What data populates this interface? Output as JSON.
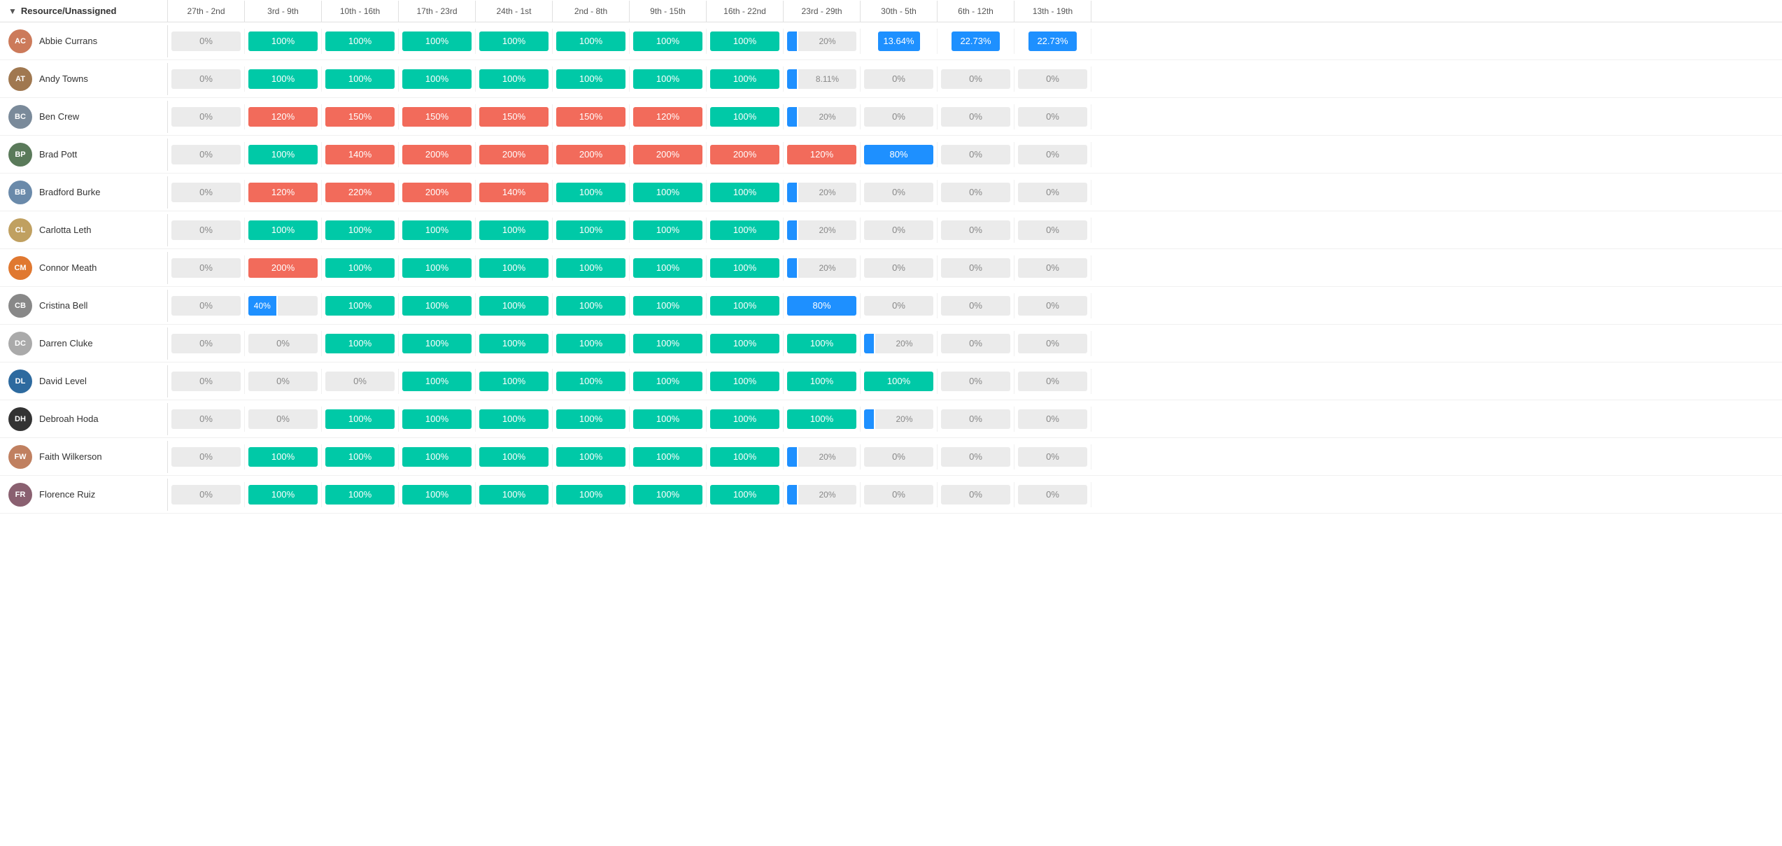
{
  "header": {
    "resource_label": "Resource/Unassigned",
    "columns": [
      "27th - 2nd",
      "3rd - 9th",
      "10th - 16th",
      "17th - 23rd",
      "24th - 1st",
      "2nd - 8th",
      "9th - 15th",
      "16th - 22nd",
      "23rd - 29th",
      "30th - 5th",
      "6th - 12th",
      "13th - 19th"
    ]
  },
  "rows": [
    {
      "name": "Abbie Currans",
      "avatar_type": "image",
      "avatar_color": "#cc7a5a",
      "initials": "AC",
      "cells": [
        {
          "type": "zero",
          "value": "0%"
        },
        {
          "type": "green",
          "value": "100%"
        },
        {
          "type": "green",
          "value": "100%"
        },
        {
          "type": "green",
          "value": "100%"
        },
        {
          "type": "green",
          "value": "100%"
        },
        {
          "type": "green",
          "value": "100%"
        },
        {
          "type": "green",
          "value": "100%"
        },
        {
          "type": "green",
          "value": "100%"
        },
        {
          "type": "partial",
          "blue_pct": 20,
          "value": "20%"
        },
        {
          "type": "blue_partial",
          "value": "13.64%",
          "pct": 60
        },
        {
          "type": "blue_partial",
          "value": "22.73%",
          "pct": 70
        },
        {
          "type": "blue_partial",
          "value": "22.73%",
          "pct": 70
        }
      ]
    },
    {
      "name": "Andy Towns",
      "avatar_type": "image",
      "avatar_color": "#a07850",
      "initials": "AT",
      "cells": [
        {
          "type": "zero",
          "value": "0%"
        },
        {
          "type": "green",
          "value": "100%"
        },
        {
          "type": "green",
          "value": "100%"
        },
        {
          "type": "green",
          "value": "100%"
        },
        {
          "type": "green",
          "value": "100%"
        },
        {
          "type": "green",
          "value": "100%"
        },
        {
          "type": "green",
          "value": "100%"
        },
        {
          "type": "green",
          "value": "100%"
        },
        {
          "type": "partial",
          "blue_pct": 15,
          "value": "8.11%"
        },
        {
          "type": "zero",
          "value": "0%"
        },
        {
          "type": "zero",
          "value": "0%"
        },
        {
          "type": "zero",
          "value": "0%"
        }
      ]
    },
    {
      "name": "Ben Crew",
      "avatar_type": "image",
      "avatar_color": "#7a8a9a",
      "initials": "BC",
      "cells": [
        {
          "type": "zero",
          "value": "0%"
        },
        {
          "type": "red",
          "value": "120%"
        },
        {
          "type": "red",
          "value": "150%"
        },
        {
          "type": "red",
          "value": "150%"
        },
        {
          "type": "red",
          "value": "150%"
        },
        {
          "type": "red",
          "value": "150%"
        },
        {
          "type": "red",
          "value": "120%"
        },
        {
          "type": "green",
          "value": "100%"
        },
        {
          "type": "partial",
          "blue_pct": 20,
          "value": "20%"
        },
        {
          "type": "zero",
          "value": "0%"
        },
        {
          "type": "zero",
          "value": "0%"
        },
        {
          "type": "zero",
          "value": "0%"
        }
      ]
    },
    {
      "name": "Brad Pott",
      "avatar_type": "image",
      "avatar_color": "#5a7a5a",
      "initials": "BP",
      "cells": [
        {
          "type": "zero",
          "value": "0%"
        },
        {
          "type": "green",
          "value": "100%"
        },
        {
          "type": "red",
          "value": "140%"
        },
        {
          "type": "red",
          "value": "200%"
        },
        {
          "type": "red",
          "value": "200%"
        },
        {
          "type": "red",
          "value": "200%"
        },
        {
          "type": "red",
          "value": "200%"
        },
        {
          "type": "red",
          "value": "200%"
        },
        {
          "type": "red",
          "value": "120%"
        },
        {
          "type": "blue",
          "value": "80%"
        },
        {
          "type": "zero",
          "value": "0%"
        },
        {
          "type": "zero",
          "value": "0%"
        }
      ]
    },
    {
      "name": "Bradford Burke",
      "avatar_type": "image",
      "avatar_color": "#6a8aaa",
      "initials": "BB",
      "cells": [
        {
          "type": "zero",
          "value": "0%"
        },
        {
          "type": "red",
          "value": "120%"
        },
        {
          "type": "red",
          "value": "220%"
        },
        {
          "type": "red",
          "value": "200%"
        },
        {
          "type": "red",
          "value": "140%"
        },
        {
          "type": "green",
          "value": "100%"
        },
        {
          "type": "green",
          "value": "100%"
        },
        {
          "type": "green",
          "value": "100%"
        },
        {
          "type": "partial",
          "blue_pct": 20,
          "value": "20%"
        },
        {
          "type": "zero",
          "value": "0%"
        },
        {
          "type": "zero",
          "value": "0%"
        },
        {
          "type": "zero",
          "value": "0%"
        }
      ]
    },
    {
      "name": "Carlotta Leth",
      "avatar_type": "image",
      "avatar_color": "#c0a060",
      "initials": "CL",
      "cells": [
        {
          "type": "zero",
          "value": "0%"
        },
        {
          "type": "green",
          "value": "100%"
        },
        {
          "type": "green",
          "value": "100%"
        },
        {
          "type": "green",
          "value": "100%"
        },
        {
          "type": "green",
          "value": "100%"
        },
        {
          "type": "green",
          "value": "100%"
        },
        {
          "type": "green",
          "value": "100%"
        },
        {
          "type": "green",
          "value": "100%"
        },
        {
          "type": "partial",
          "blue_pct": 20,
          "value": "20%"
        },
        {
          "type": "zero",
          "value": "0%"
        },
        {
          "type": "zero",
          "value": "0%"
        },
        {
          "type": "zero",
          "value": "0%"
        }
      ]
    },
    {
      "name": "Connor Meath",
      "avatar_type": "image",
      "avatar_color": "#e07830",
      "initials": "CM",
      "cells": [
        {
          "type": "zero",
          "value": "0%"
        },
        {
          "type": "red",
          "value": "200%"
        },
        {
          "type": "green",
          "value": "100%"
        },
        {
          "type": "green",
          "value": "100%"
        },
        {
          "type": "green",
          "value": "100%"
        },
        {
          "type": "green",
          "value": "100%"
        },
        {
          "type": "green",
          "value": "100%"
        },
        {
          "type": "green",
          "value": "100%"
        },
        {
          "type": "partial",
          "blue_pct": 20,
          "value": "20%"
        },
        {
          "type": "zero",
          "value": "0%"
        },
        {
          "type": "zero",
          "value": "0%"
        },
        {
          "type": "zero",
          "value": "0%"
        }
      ]
    },
    {
      "name": "Cristina Bell",
      "avatar_type": "image",
      "avatar_color": "#888888",
      "initials": "CB",
      "cells": [
        {
          "type": "zero",
          "value": "0%"
        },
        {
          "type": "blue_small",
          "value": "40%",
          "pct": 40
        },
        {
          "type": "green",
          "value": "100%"
        },
        {
          "type": "green",
          "value": "100%"
        },
        {
          "type": "green",
          "value": "100%"
        },
        {
          "type": "green",
          "value": "100%"
        },
        {
          "type": "green",
          "value": "100%"
        },
        {
          "type": "green",
          "value": "100%"
        },
        {
          "type": "blue",
          "value": "80%"
        },
        {
          "type": "zero",
          "value": "0%"
        },
        {
          "type": "zero",
          "value": "0%"
        },
        {
          "type": "zero",
          "value": "0%"
        }
      ]
    },
    {
      "name": "Darren Cluke",
      "avatar_type": "image",
      "avatar_color": "#aaaaaa",
      "initials": "DC",
      "cells": [
        {
          "type": "zero",
          "value": "0%"
        },
        {
          "type": "zero",
          "value": "0%"
        },
        {
          "type": "green",
          "value": "100%"
        },
        {
          "type": "green",
          "value": "100%"
        },
        {
          "type": "green",
          "value": "100%"
        },
        {
          "type": "green",
          "value": "100%"
        },
        {
          "type": "green",
          "value": "100%"
        },
        {
          "type": "green",
          "value": "100%"
        },
        {
          "type": "green",
          "value": "100%"
        },
        {
          "type": "partial",
          "blue_pct": 20,
          "value": "20%"
        },
        {
          "type": "zero",
          "value": "0%"
        },
        {
          "type": "zero",
          "value": "0%"
        }
      ]
    },
    {
      "name": "David Level",
      "avatar_type": "initials",
      "avatar_color": "#2d6a9f",
      "initials": "DL",
      "cells": [
        {
          "type": "zero",
          "value": "0%"
        },
        {
          "type": "zero",
          "value": "0%"
        },
        {
          "type": "zero",
          "value": "0%"
        },
        {
          "type": "green",
          "value": "100%"
        },
        {
          "type": "green",
          "value": "100%"
        },
        {
          "type": "green",
          "value": "100%"
        },
        {
          "type": "green",
          "value": "100%"
        },
        {
          "type": "green",
          "value": "100%"
        },
        {
          "type": "green",
          "value": "100%"
        },
        {
          "type": "green",
          "value": "100%"
        },
        {
          "type": "zero",
          "value": "0%"
        },
        {
          "type": "zero",
          "value": "0%"
        }
      ]
    },
    {
      "name": "Debroah Hoda",
      "avatar_type": "initials",
      "avatar_color": "#333333",
      "initials": "DH",
      "cells": [
        {
          "type": "zero",
          "value": "0%"
        },
        {
          "type": "zero",
          "value": "0%"
        },
        {
          "type": "green",
          "value": "100%"
        },
        {
          "type": "green",
          "value": "100%"
        },
        {
          "type": "green",
          "value": "100%"
        },
        {
          "type": "green",
          "value": "100%"
        },
        {
          "type": "green",
          "value": "100%"
        },
        {
          "type": "green",
          "value": "100%"
        },
        {
          "type": "green",
          "value": "100%"
        },
        {
          "type": "partial",
          "blue_pct": 20,
          "value": "20%"
        },
        {
          "type": "zero",
          "value": "0%"
        },
        {
          "type": "zero",
          "value": "0%"
        }
      ]
    },
    {
      "name": "Faith Wilkerson",
      "avatar_type": "image",
      "avatar_color": "#c08060",
      "initials": "FW",
      "cells": [
        {
          "type": "zero",
          "value": "0%"
        },
        {
          "type": "green",
          "value": "100%"
        },
        {
          "type": "green",
          "value": "100%"
        },
        {
          "type": "green",
          "value": "100%"
        },
        {
          "type": "green",
          "value": "100%"
        },
        {
          "type": "green",
          "value": "100%"
        },
        {
          "type": "green",
          "value": "100%"
        },
        {
          "type": "green",
          "value": "100%"
        },
        {
          "type": "partial",
          "blue_pct": 20,
          "value": "20%"
        },
        {
          "type": "zero",
          "value": "0%"
        },
        {
          "type": "zero",
          "value": "0%"
        },
        {
          "type": "zero",
          "value": "0%"
        }
      ]
    },
    {
      "name": "Florence Ruiz",
      "avatar_type": "image",
      "avatar_color": "#8a6070",
      "initials": "FR",
      "cells": [
        {
          "type": "zero",
          "value": "0%"
        },
        {
          "type": "green",
          "value": "100%"
        },
        {
          "type": "green",
          "value": "100%"
        },
        {
          "type": "green",
          "value": "100%"
        },
        {
          "type": "green",
          "value": "100%"
        },
        {
          "type": "green",
          "value": "100%"
        },
        {
          "type": "green",
          "value": "100%"
        },
        {
          "type": "green",
          "value": "100%"
        },
        {
          "type": "partial",
          "blue_pct": 20,
          "value": "20%"
        },
        {
          "type": "zero",
          "value": "0%"
        },
        {
          "type": "zero",
          "value": "0%"
        },
        {
          "type": "zero",
          "value": "0%"
        }
      ]
    }
  ]
}
